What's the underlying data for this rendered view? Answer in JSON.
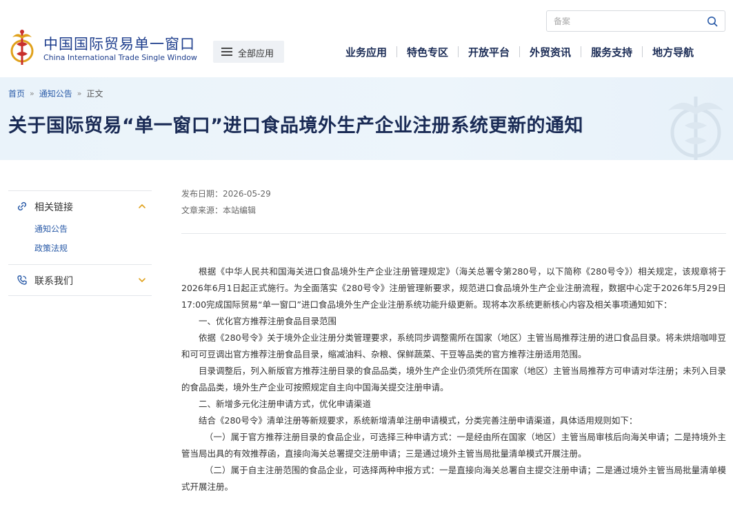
{
  "header": {
    "logo_cn": "中国国际贸易单一窗口",
    "logo_en": "China International Trade Single Window",
    "all_apps_label": "全部应用",
    "search_placeholder": "备案",
    "nav": [
      "业务应用",
      "特色专区",
      "开放平台",
      "外贸资讯",
      "服务支持",
      "地方导航"
    ]
  },
  "breadcrumb": {
    "home": "首页",
    "section": "通知公告",
    "current": "正文",
    "separator": "»"
  },
  "page_title": "关于国际贸易“单一窗口”进口食品境外生产企业注册系统更新的通知",
  "sidebar": {
    "sections": [
      {
        "title": "相关链接",
        "icon": "link-icon",
        "expanded": true,
        "links": [
          "通知公告",
          "政策法规"
        ]
      },
      {
        "title": "联系我们",
        "icon": "phone-icon",
        "expanded": false,
        "links": []
      }
    ]
  },
  "meta": {
    "publish_date": "发布日期：2026-05-29",
    "source": "文章来源：本站编辑"
  },
  "article": {
    "paragraphs": [
      "根据《中华人民共和国海关进口食品境外生产企业注册管理规定》（海关总署令第280号，以下简称《280号令》）相关规定，该规章将于2026年6月1日起正式施行。为全面落实《280号令》注册管理新要求，规范进口食品境外生产企业注册流程，数据中心定于2026年5月29日17:00完成国际贸易“单一窗口”进口食品境外生产企业注册系统功能升级更新。现将本次系统更新核心内容及相关事项通知如下：",
      "一、优化官方推荐注册食品目录范围",
      "依据《280号令》关于境外企业注册分类管理要求，系统同步调整需所在国家（地区）主管当局推荐注册的进口食品目录。将未烘焙咖啡豆和可可豆调出官方推荐注册食品目录，缩减油料、杂粮、保鲜蔬菜、干豆等品类的官方推荐注册适用范围。",
      "目录调整后，列入新版官方推荐注册目录的食品品类，境外生产企业仍须凭所在国家（地区）主管当局推荐方可申请对华注册；未列入目录的食品品类，境外生产企业可按照规定自主向中国海关提交注册申请。",
      "二、新增多元化注册申请方式，优化申请渠道",
      "结合《280号令》清单注册等新规要求，系统新增清单注册申请模式，分类完善注册申请渠道，具体适用规则如下：",
      "（一）属于官方推荐注册目录的食品企业，可选择三种申请方式：一是经由所在国家（地区）主管当局审核后向海关申请；二是持境外主管当局出具的有效推荐函，直接向海关总署提交注册申请；三是通过境外主管当局批量清单模式开展注册。",
      "（二）属于自主注册范围的食品企业，可选择两种申报方式：一是直接向海关总署自主提交注册申请；二是通过境外主管当局批量清单模式开展注册。"
    ]
  },
  "colors": {
    "brand_navy": "#1a2b55",
    "link_blue": "#2a5ba8",
    "logo_gold": "#e0a11b",
    "logo_red": "#c8302c",
    "banner_bg": "#eaf3fa"
  }
}
